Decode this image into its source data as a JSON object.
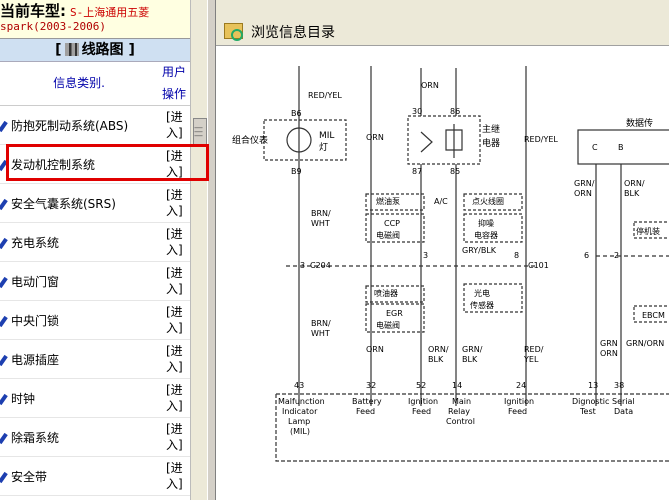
{
  "header": {
    "label": "当前车型:",
    "model": "S-上海通用五菱",
    "model_line2": "spark(2003-2006)"
  },
  "section": {
    "left_bracket": "[",
    "title": "线路图",
    "right_bracket": "]"
  },
  "table": {
    "col_type": "信息类别.",
    "col_op_1": "用户",
    "col_op_2": "操作",
    "rows": [
      {
        "label": "防抱死制动系统(ABS)",
        "op1": "[进",
        "op2": "入]"
      },
      {
        "label": "发动机控制系统",
        "op1": "[进",
        "op2": "入]"
      },
      {
        "label": "安全气囊系统(SRS)",
        "op1": "[进",
        "op2": "入]"
      },
      {
        "label": "充电系统",
        "op1": "[进",
        "op2": "入]"
      },
      {
        "label": "电动门窗",
        "op1": "[进",
        "op2": "入]"
      },
      {
        "label": "中央门锁",
        "op1": "[进",
        "op2": "入]"
      },
      {
        "label": "电源插座",
        "op1": "[进",
        "op2": "入]"
      },
      {
        "label": "时钟",
        "op1": "[进",
        "op2": "入]"
      },
      {
        "label": "除霜系统",
        "op1": "[进",
        "op2": "入]"
      },
      {
        "label": "安全带",
        "op1": "[进",
        "op2": "入]"
      }
    ]
  },
  "right": {
    "title": "浏览信息目录"
  },
  "diagram": {
    "wire_red_yel": "RED/YEL",
    "wire_orn": "ORN",
    "pin_b6": "B6",
    "pin_b9": "B9",
    "cluster": "组合仪表",
    "mil": "MIL",
    "lamp": "灯",
    "p30": "30",
    "p86": "86",
    "p87": "87",
    "p85": "85",
    "relay": "主继",
    "relay2": "电器",
    "datalink": "数据传",
    "c": "C",
    "b": "B",
    "grn_orn": "GRN/",
    "grn_orn2": "ORN",
    "orn_blk": "ORN/",
    "orn_blk2": "BLK",
    "fuel_pump": "燃油泵",
    "ac": "A/C",
    "ign_coil": "点火线圈",
    "ccp": "CCP",
    "ccp2": "电磁阀",
    "suppressor": "抑噪",
    "suppressor2": "电容器",
    "stop_lamp": "停机装",
    "brn_wht": "BRN/",
    "brn_wht2": "WHT",
    "c204": "C204",
    "gry_blk": "GRY/BLK",
    "c101": "C101",
    "n3": "3",
    "n2": "2",
    "n8": "8",
    "n6": "6",
    "injector": "喷油器",
    "sensor": "光电",
    "sensor2": "传感器",
    "egr": "EGR",
    "egr2": "电磁阀",
    "ebcm": "EBCM",
    "orn_blk_a": "ORN/",
    "orn_blk_b": "BLK",
    "grn_blk_a": "GRN/",
    "grn_blk_b": "BLK",
    "red_yel_a": "RED/",
    "red_yel_b": "YEL",
    "grn_orn_a": "GRN",
    "grn_orn_b": "ORN",
    "grn_orn_c": "GRN/ORN",
    "t43": "43",
    "t32": "32",
    "t52": "52",
    "t14": "14",
    "t24": "24",
    "t13": "13",
    "t38": "38",
    "mil_1": "Malfunction",
    "mil_2": "Indicator",
    "mil_3": "Lamp",
    "mil_4": "(MIL)",
    "bat_1": "Battery",
    "bat_2": "Feed",
    "ign_1": "Ignition",
    "ign_2": "Feed",
    "relay_1": "Main",
    "relay_2": "Relay",
    "relay_3": "Control",
    "ign2_1": "Ignition",
    "ign2_2": "Feed",
    "diag_1": "Dignostic",
    "diag_2": "Test",
    "ser_1": "Serial",
    "ser_2": "Data"
  }
}
